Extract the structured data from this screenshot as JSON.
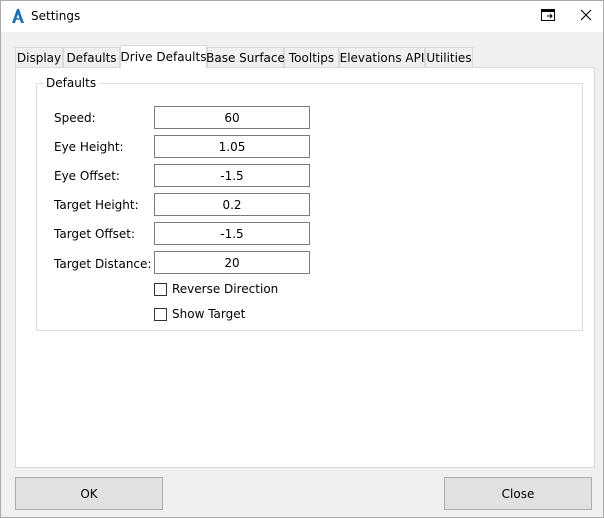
{
  "window": {
    "title": "Settings"
  },
  "tabs": [
    {
      "label": "Display",
      "active": false
    },
    {
      "label": "Defaults",
      "active": false
    },
    {
      "label": "Drive Defaults",
      "active": true
    },
    {
      "label": "Base Surface",
      "active": false
    },
    {
      "label": "Tooltips",
      "active": false
    },
    {
      "label": "Elevations API",
      "active": false
    },
    {
      "label": "Utilities",
      "active": false
    }
  ],
  "group": {
    "title": "Defaults",
    "fields": [
      {
        "label": "Speed:",
        "value": "60"
      },
      {
        "label": "Eye Height:",
        "value": "1.05"
      },
      {
        "label": "Eye Offset:",
        "value": "-1.5"
      },
      {
        "label": "Target Height:",
        "value": "0.2"
      },
      {
        "label": "Target Offset:",
        "value": "-1.5"
      },
      {
        "label": "Target Distance:",
        "value": "20"
      }
    ],
    "checkboxes": [
      {
        "label": "Reverse Direction",
        "checked": false
      },
      {
        "label": "Show Target",
        "checked": false
      }
    ]
  },
  "buttons": {
    "ok_label": "OK",
    "close_label": "Close"
  },
  "colors": {
    "app_icon": "#1f6fb2",
    "window_bg": "#f0f0f0",
    "panel_bg": "#ffffff",
    "button_bg": "#e1e1e1"
  }
}
